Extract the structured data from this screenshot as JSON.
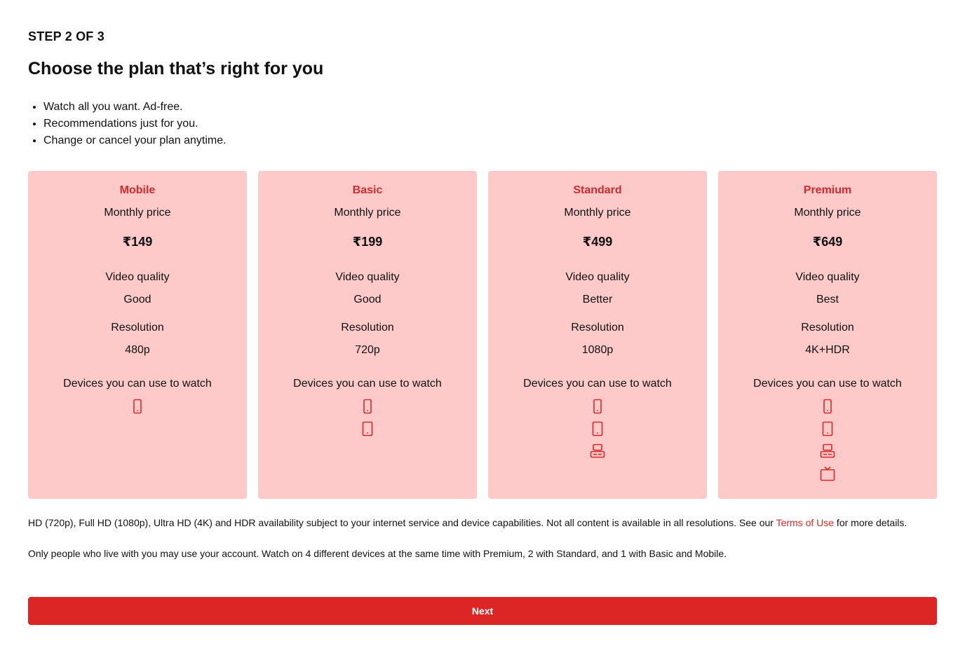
{
  "step_label": "STEP 2 OF 3",
  "title": "Choose the plan that’s right for you",
  "benefits": [
    "Watch all you want. Ad-free.",
    "Recommendations just for you.",
    "Change or cancel your plan anytime."
  ],
  "colors": {
    "accent": "#dc2626",
    "card_bg": "#fdc9c9",
    "plan_name": "#d62a2a"
  },
  "plans": [
    {
      "name": "Mobile",
      "price_label": "Monthly price",
      "price": "₹149",
      "quality_label": "Video quality",
      "quality": "Good",
      "resolution_label": "Resolution",
      "resolution": "480p",
      "devices_label": "Devices you can use to watch",
      "devices": [
        "phone-icon"
      ]
    },
    {
      "name": "Basic",
      "price_label": "Monthly price",
      "price": "₹199",
      "quality_label": "Video quality",
      "quality": "Good",
      "resolution_label": "Resolution",
      "resolution": "720p",
      "devices_label": "Devices you can use to watch",
      "devices": [
        "phone-icon",
        "tablet-icon"
      ]
    },
    {
      "name": "Standard",
      "price_label": "Monthly price",
      "price": "₹499",
      "quality_label": "Video quality",
      "quality": "Better",
      "resolution_label": "Resolution",
      "resolution": "1080p",
      "devices_label": "Devices you can use to watch",
      "devices": [
        "phone-icon",
        "tablet-icon",
        "computer-icon"
      ]
    },
    {
      "name": "Premium",
      "price_label": "Monthly price",
      "price": "₹649",
      "quality_label": "Video quality",
      "quality": "Best",
      "resolution_label": "Resolution",
      "resolution": "4K+HDR",
      "devices_label": "Devices you can use to watch",
      "devices": [
        "phone-icon",
        "tablet-icon",
        "computer-icon",
        "tv-icon"
      ]
    }
  ],
  "notes": {
    "availability_before": "HD (720p), Full HD (1080p), Ultra HD (4K) and HDR availability subject to your internet service and device capabilities. Not all content is available in all resolutions. See our ",
    "terms_link": "Terms of Use",
    "availability_after": " for more details.",
    "household": "Only people who live with you may use your account. Watch on 4 different devices at the same time with Premium, 2 with Standard, and 1 with Basic and Mobile."
  },
  "next_label": "Next"
}
